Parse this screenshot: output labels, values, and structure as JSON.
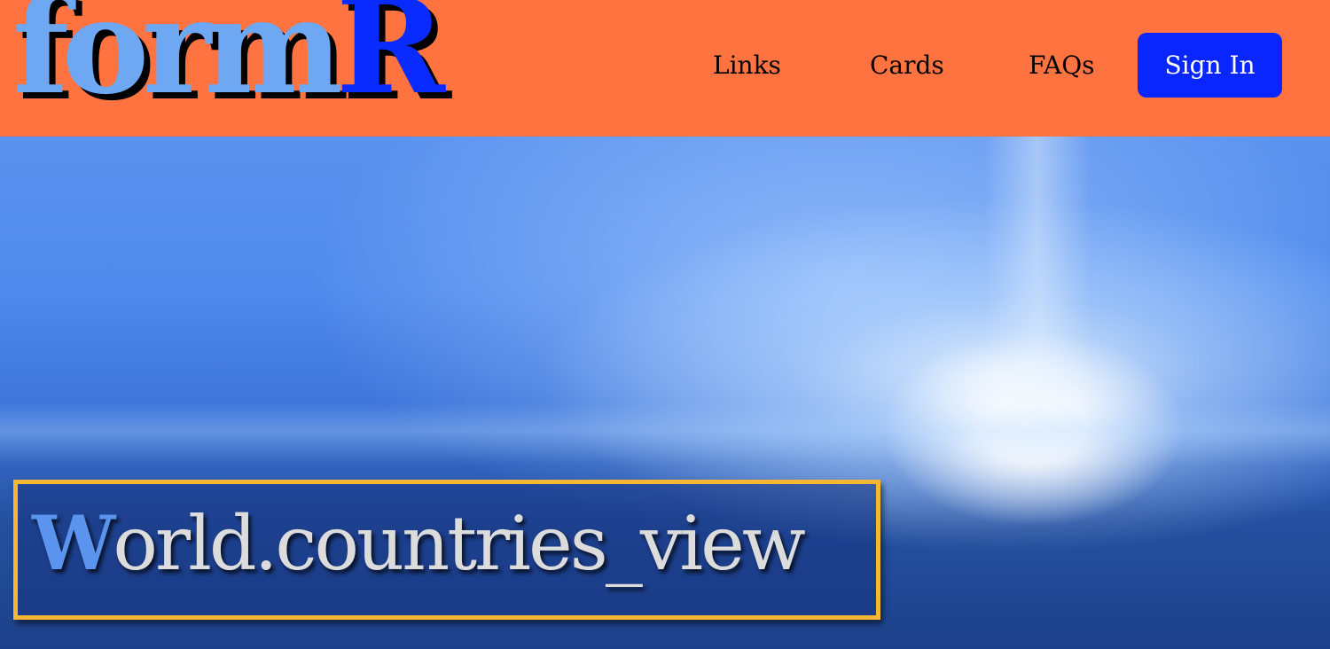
{
  "brand": {
    "logo_part1": "form",
    "logo_part2": "R",
    "logo_color_primary": "#6ea7f2",
    "logo_color_accent": "#0a2bff"
  },
  "nav": {
    "links_label": "Links",
    "cards_label": "Cards",
    "faqs_label": "FAQs",
    "signin_label": "Sign In",
    "bar_color": "#ff7340",
    "signin_color": "#0a26ff"
  },
  "hero": {
    "title_first_letter": "W",
    "title_rest": "orld.countries_view",
    "frame_color": "#f7b733"
  }
}
